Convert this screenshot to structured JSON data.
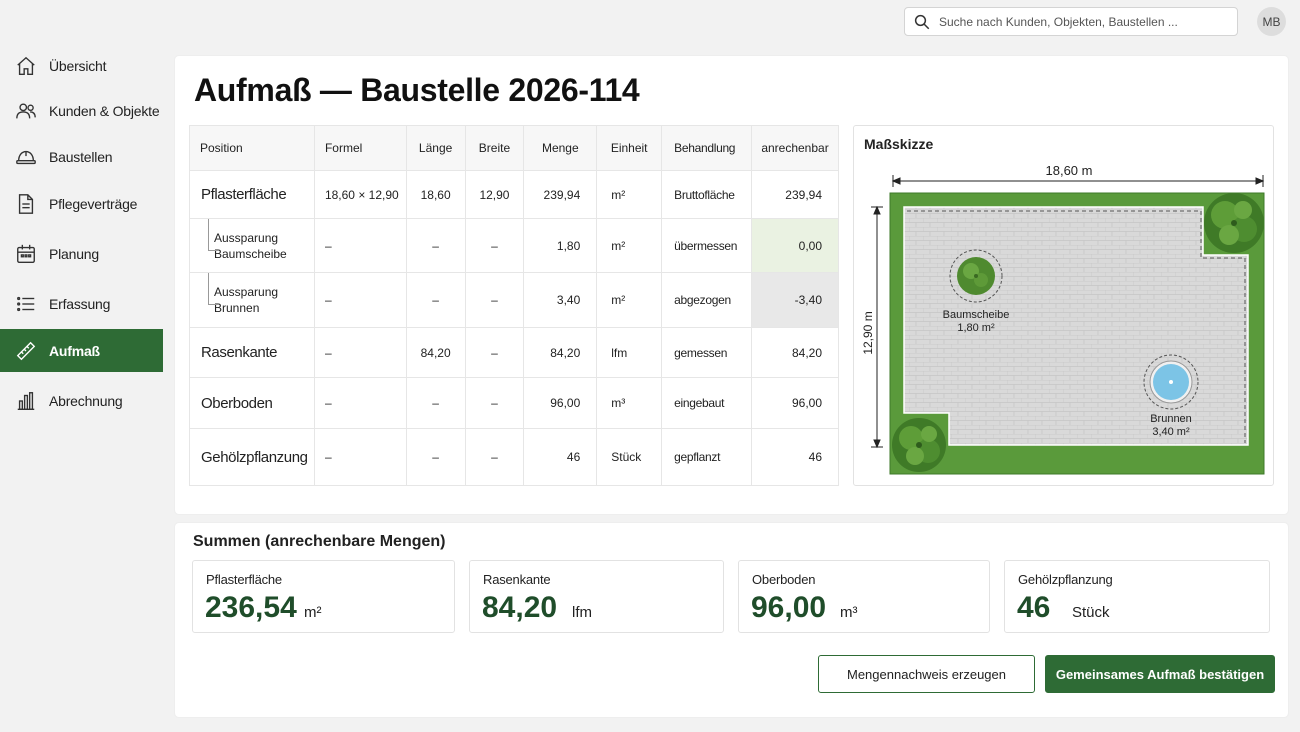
{
  "header": {
    "search_placeholder": "Suche nach Kunden, Objekten, Baustellen ...",
    "avatar_initials": "MB"
  },
  "sidebar": {
    "items": [
      {
        "label": "Übersicht",
        "icon": "home-icon"
      },
      {
        "label": "Kunden & Objekte",
        "icon": "users-icon"
      },
      {
        "label": "Baustellen",
        "icon": "hardhat-icon"
      },
      {
        "label": "Pflegeverträge",
        "icon": "document-icon"
      },
      {
        "label": "Planung",
        "icon": "calendar-icon"
      },
      {
        "label": "Erfassung",
        "icon": "list-icon"
      },
      {
        "label": "Aufmaß",
        "icon": "ruler-icon",
        "active": true
      },
      {
        "label": "Abrechnung",
        "icon": "bar-chart-icon"
      }
    ],
    "accent_color": "#2e6b35"
  },
  "page": {
    "title": "Aufmaß — Baustelle 2026-114"
  },
  "table": {
    "headers": {
      "position": "Position",
      "formel": "Formel",
      "laenge": "Länge",
      "breite": "Breite",
      "menge": "Menge",
      "einheit": "Einheit",
      "behandlung": "Behandlung",
      "anrechenbar": "anrechenbar"
    },
    "rows": [
      {
        "position": "Pflasterfläche",
        "formel": "18,60 × 12,90",
        "laenge": "18,60",
        "breite": "12,90",
        "menge": "239,94",
        "einheit": "m²",
        "behandlung": "Bruttofläche",
        "anrechenbar": "239,94"
      },
      {
        "position": "Aussparung Baumscheibe",
        "formel": "–",
        "laenge": "–",
        "breite": "–",
        "menge": "1,80",
        "einheit": "m²",
        "behandlung": "übermessen",
        "anrechenbar": "0,00"
      },
      {
        "position": "Aussparung Brunnen",
        "formel": "–",
        "laenge": "–",
        "breite": "–",
        "menge": "3,40",
        "einheit": "m²",
        "behandlung": "abgezogen",
        "anrechenbar": "-3,40"
      },
      {
        "position": "Rasenkante",
        "formel": "–",
        "laenge": "84,20",
        "breite": "–",
        "menge": "84,20",
        "einheit": "lfm",
        "behandlung": "gemessen",
        "anrechenbar": "84,20"
      },
      {
        "position": "Oberboden",
        "formel": "–",
        "laenge": "–",
        "breite": "–",
        "menge": "96,00",
        "einheit": "m³",
        "behandlung": "eingebaut",
        "anrechenbar": "96,00"
      },
      {
        "position": "Gehölzpflanzung",
        "formel": "–",
        "laenge": "–",
        "breite": "–",
        "menge": "46",
        "einheit": "Stück",
        "behandlung": "gepflanzt",
        "anrechenbar": "46"
      }
    ]
  },
  "sketch": {
    "title": "Maßskizze",
    "width_label": "18,60  m",
    "height_label": "12,90  m",
    "baumscheibe_label": "Baumscheibe",
    "baumscheibe_area": "1,80 m²",
    "brunnen_label": "Brunnen",
    "brunnen_area": "3,40 m²"
  },
  "summary": {
    "title": "Summen (anrechenbare Mengen)",
    "cards": [
      {
        "label": "Pflasterfläche",
        "value": "236,54",
        "unit": "m²"
      },
      {
        "label": "Rasenkante",
        "value": "84,20",
        "unit": "lfm"
      },
      {
        "label": "Oberboden",
        "value": "96,00",
        "unit": "m³"
      },
      {
        "label": "Gehölzpflanzung",
        "value": "46",
        "unit": "Stück"
      }
    ]
  },
  "actions": {
    "secondary": "Mengennachweis  erzeugen",
    "primary": "Gemeinsames  Aufmaß  bestätigen"
  }
}
